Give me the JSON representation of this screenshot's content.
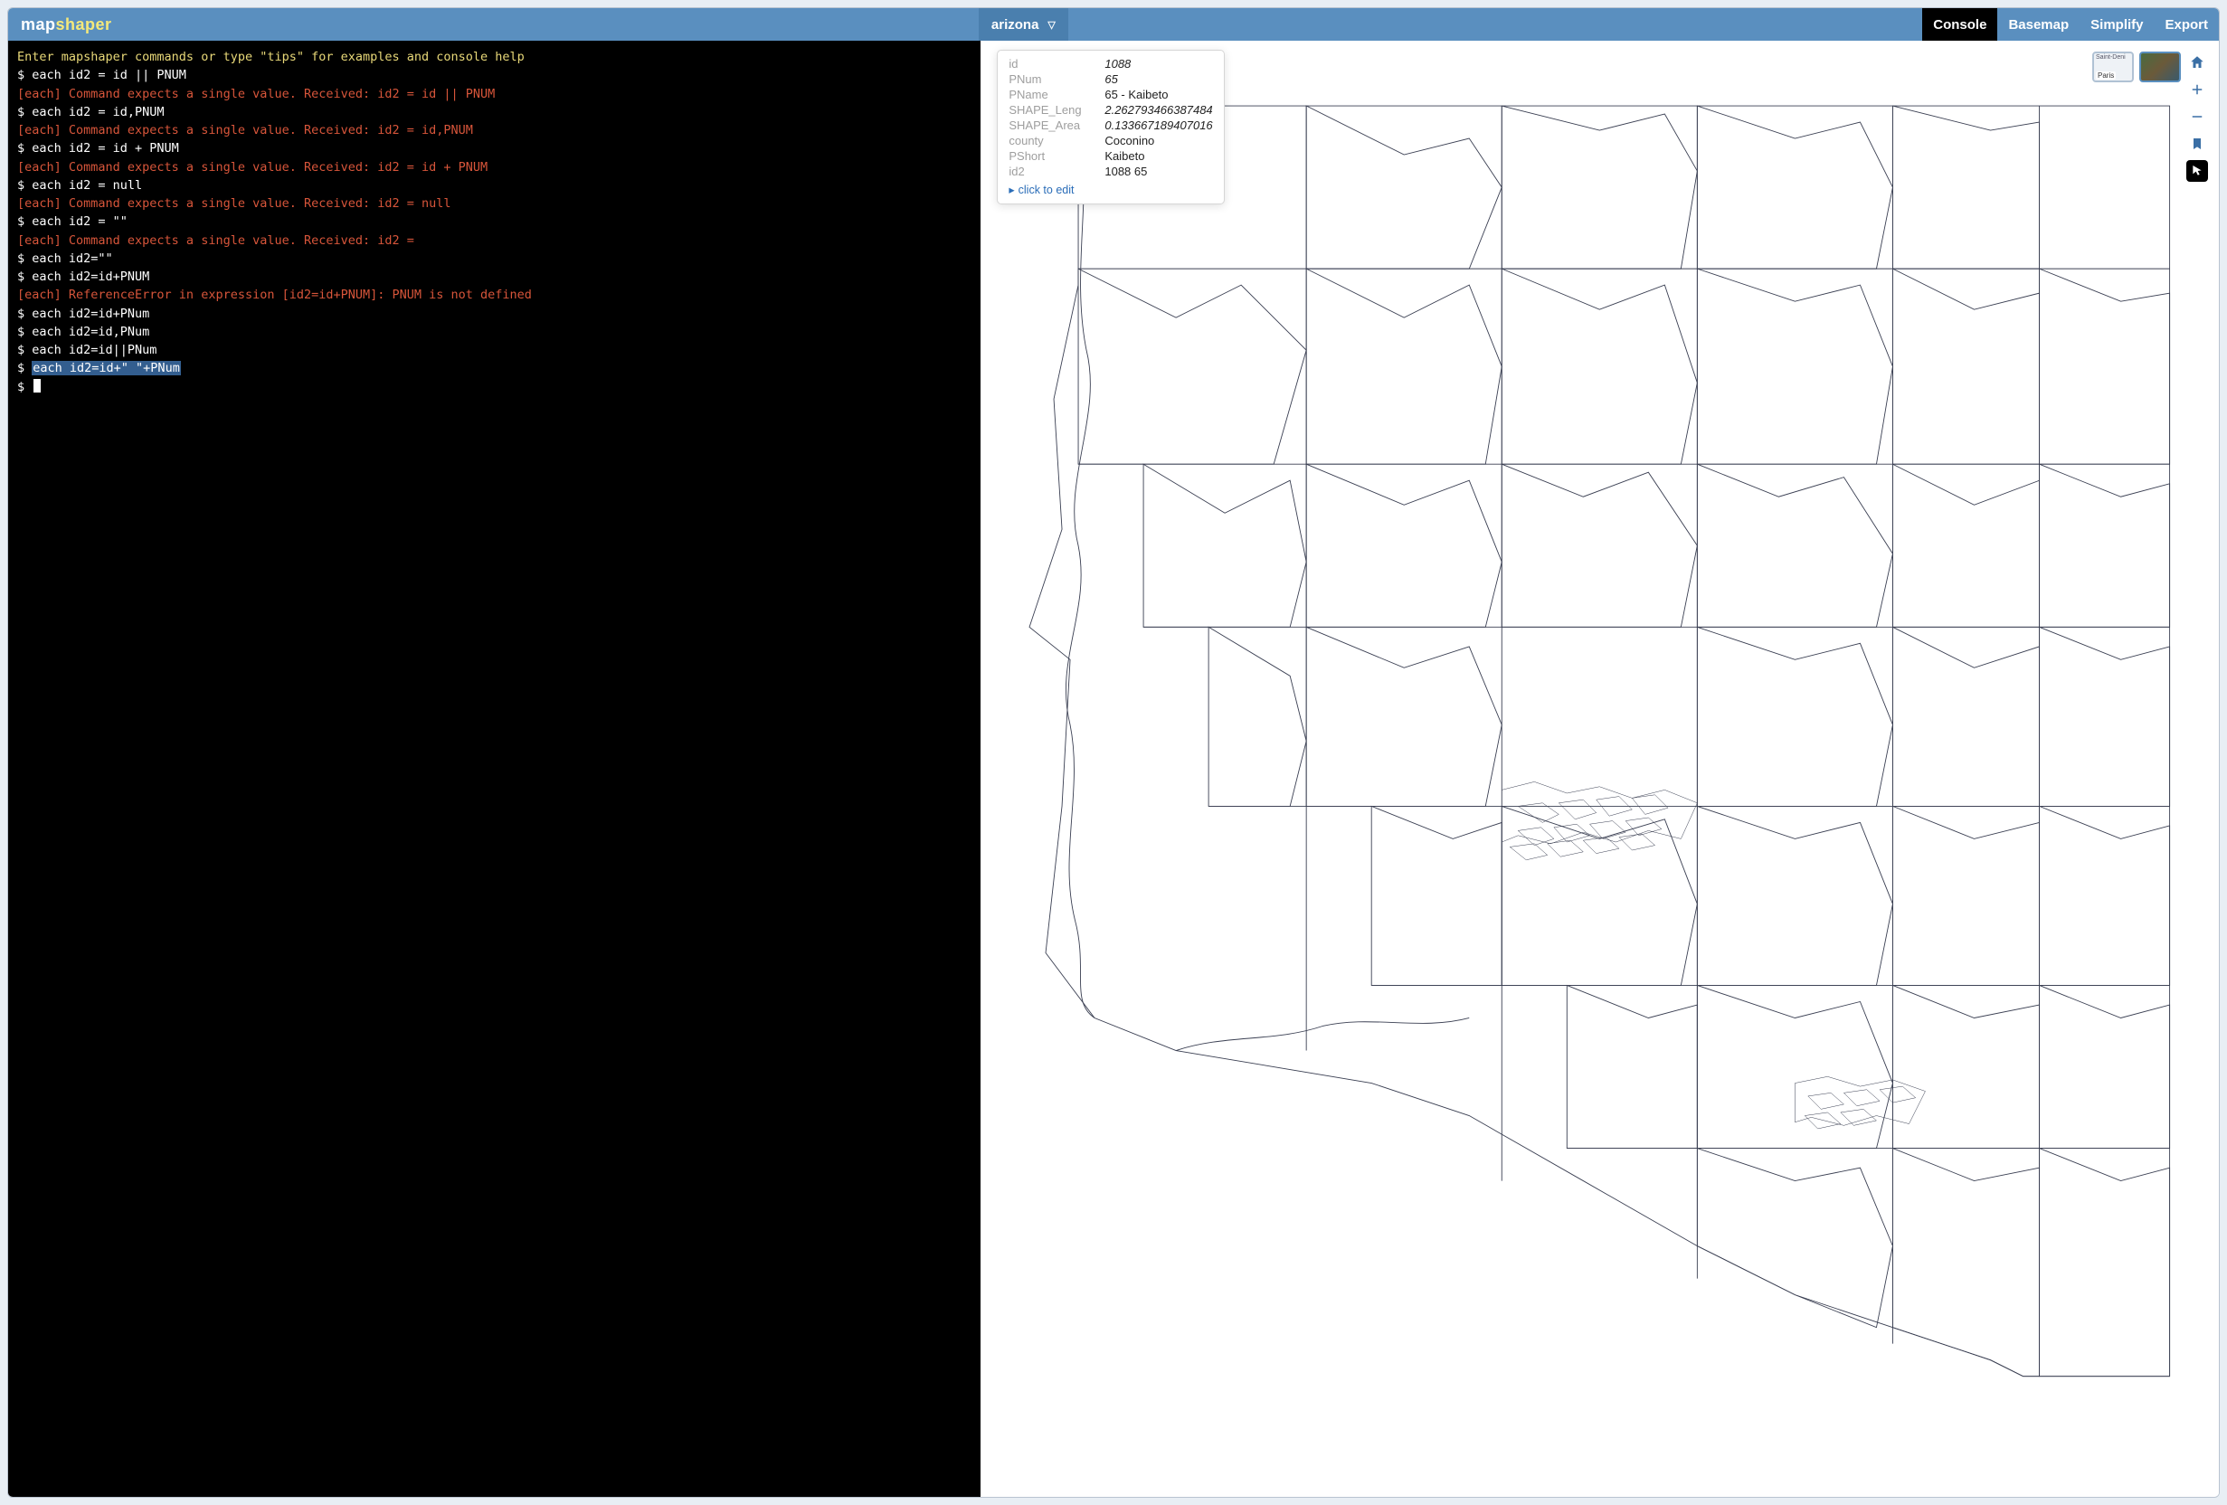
{
  "header": {
    "logo_map": "map",
    "logo_shaper": "shaper",
    "layer_name": "arizona",
    "nav": {
      "console": "Console",
      "basemap": "Basemap",
      "simplify": "Simplify",
      "export": "Export"
    }
  },
  "console": {
    "intro": "Enter mapshaper commands or type \"tips\" for examples and console help",
    "lines": [
      {
        "type": "cmd",
        "text": "$ each id2 = id || PNUM"
      },
      {
        "type": "err",
        "text": "[each] Command expects a single value. Received: id2 = id || PNUM"
      },
      {
        "type": "cmd",
        "text": "$ each id2 = id,PNUM"
      },
      {
        "type": "err",
        "text": "[each] Command expects a single value. Received: id2 = id,PNUM"
      },
      {
        "type": "cmd",
        "text": "$ each id2 = id + PNUM"
      },
      {
        "type": "err",
        "text": "[each] Command expects a single value. Received: id2 = id + PNUM"
      },
      {
        "type": "cmd",
        "text": "$ each id2 = null"
      },
      {
        "type": "err",
        "text": "[each] Command expects a single value. Received: id2 = null"
      },
      {
        "type": "cmd",
        "text": "$ each id2 = \"\""
      },
      {
        "type": "err",
        "text": "[each] Command expects a single value. Received: id2 ="
      },
      {
        "type": "cmd",
        "text": "$ each id2=\"\""
      },
      {
        "type": "cmd",
        "text": "$ each id2=id+PNUM"
      },
      {
        "type": "err",
        "text": "[each] ReferenceError in expression [id2=id+PNUM]: PNUM is not defined"
      },
      {
        "type": "cmd",
        "text": "$ each id2=id+PNum"
      },
      {
        "type": "cmd",
        "text": "$ each id2=id,PNum"
      },
      {
        "type": "cmd",
        "text": "$ each id2=id||PNum"
      },
      {
        "type": "cmd_sel",
        "prefix": "$ ",
        "sel": "each id2=id+\" \"+PNum"
      },
      {
        "type": "prompt",
        "text": "$ "
      }
    ]
  },
  "popup": {
    "rows": [
      {
        "key": "id",
        "val": "1088",
        "italic": true
      },
      {
        "key": "PNum",
        "val": "65",
        "italic": true
      },
      {
        "key": "PName",
        "val": "65 - Kaibeto",
        "italic": false
      },
      {
        "key": "SHAPE_Leng",
        "val": "2.262793466387484",
        "italic": true
      },
      {
        "key": "SHAPE_Area",
        "val": "0.133667189407016",
        "italic": true
      },
      {
        "key": "county",
        "val": "Coconino",
        "italic": false
      },
      {
        "key": "PShort",
        "val": "Kaibeto",
        "italic": false
      },
      {
        "key": "id2",
        "val": "1088 65",
        "italic": false
      }
    ],
    "edit_label": "click to edit"
  },
  "basemap_thumbs": {
    "streets_label": "Paris",
    "streets_top": "Saint-Deni"
  },
  "icons": {
    "home": "home-icon",
    "plus": "zoom-in-icon",
    "minus": "zoom-out-icon",
    "bookmark": "bookmark-icon",
    "cursor": "cursor-icon"
  }
}
